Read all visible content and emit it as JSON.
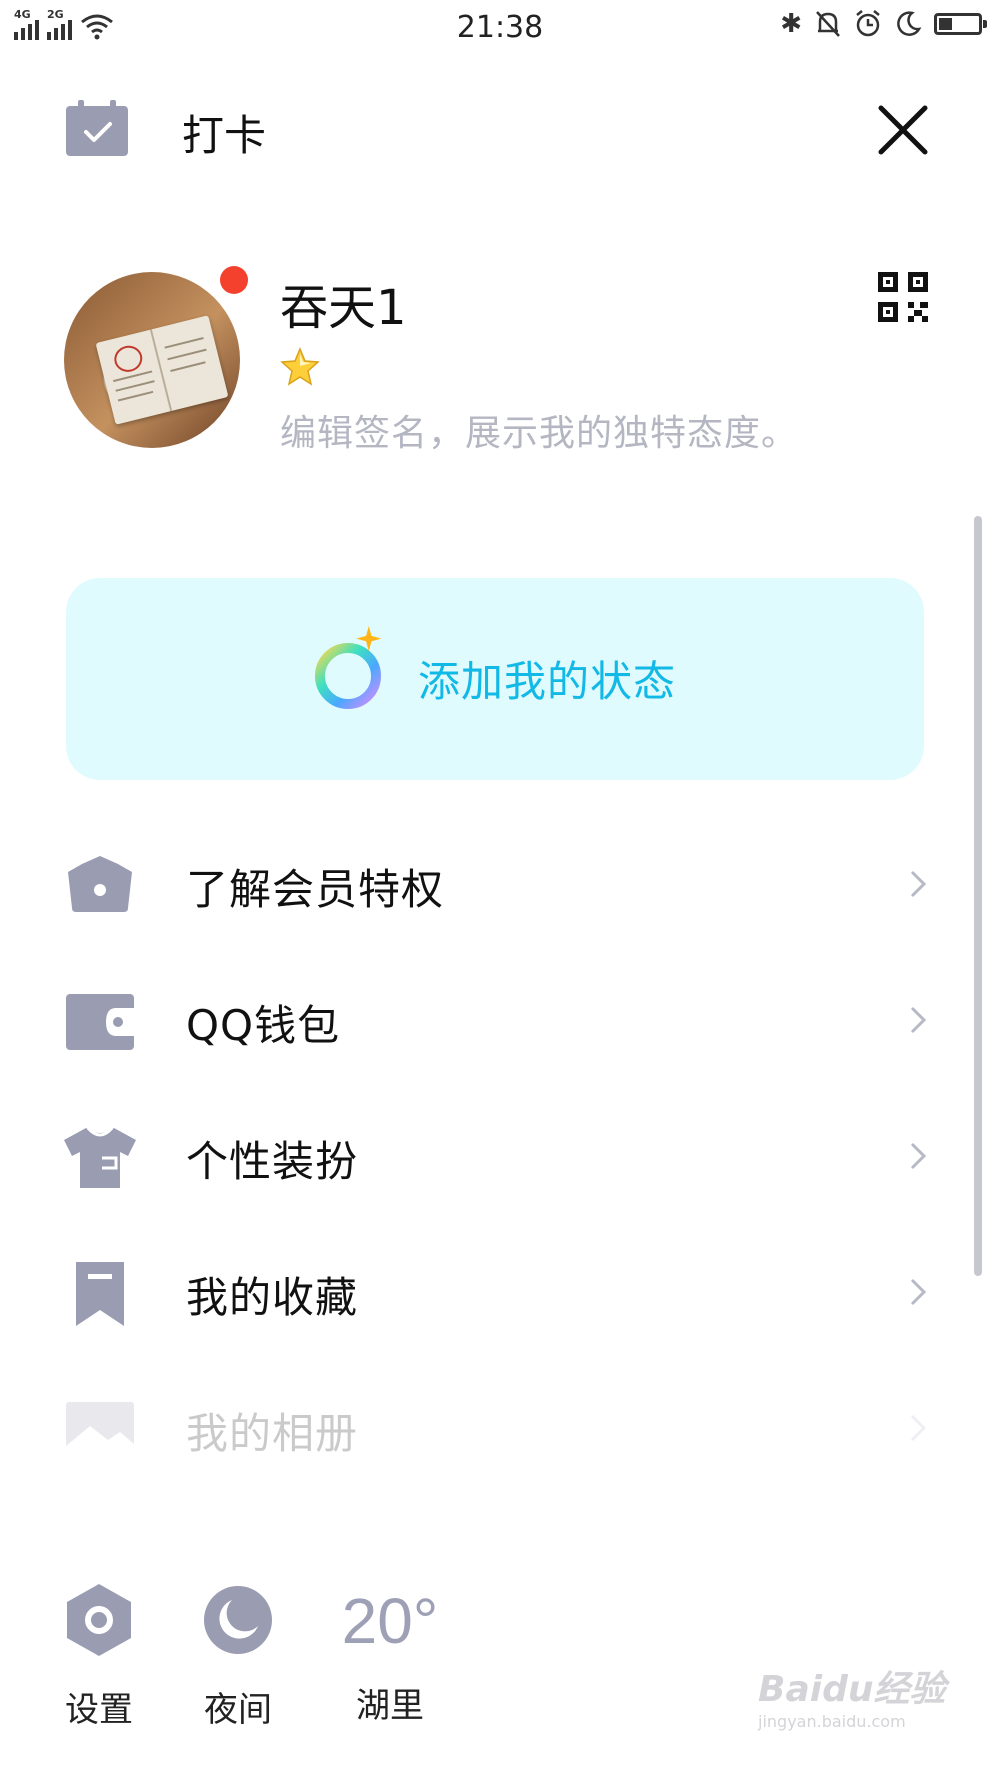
{
  "status_bar": {
    "network_1": "4G",
    "network_2": "2G",
    "time": "21:38",
    "battery_level": 0.35
  },
  "header": {
    "checkin_label": "打卡"
  },
  "profile": {
    "nickname": "吞天1",
    "signature_placeholder": "编辑签名，展示我的独特态度。"
  },
  "status_card": {
    "label": "添加我的状态"
  },
  "menu": [
    {
      "label": "了解会员特权",
      "icon": "crown-icon"
    },
    {
      "label": "QQ钱包",
      "icon": "wallet-icon"
    },
    {
      "label": "个性装扮",
      "icon": "tshirt-icon"
    },
    {
      "label": "我的收藏",
      "icon": "bookmark-icon"
    },
    {
      "label": "我的相册",
      "icon": "image-icon"
    }
  ],
  "bottom_bar": {
    "settings_label": "设置",
    "night_label": "夜间",
    "temperature": "20°",
    "city": "湖里"
  },
  "watermark": {
    "brand": "Baidu经验",
    "url": "jingyan.baidu.com"
  },
  "colors": {
    "icon_gray": "#9a9cb2",
    "status_text": "#12b9e6",
    "status_card_bg": "#e0fbfd",
    "badge_red": "#f4412e",
    "signature_gray": "#b4b6c2"
  }
}
